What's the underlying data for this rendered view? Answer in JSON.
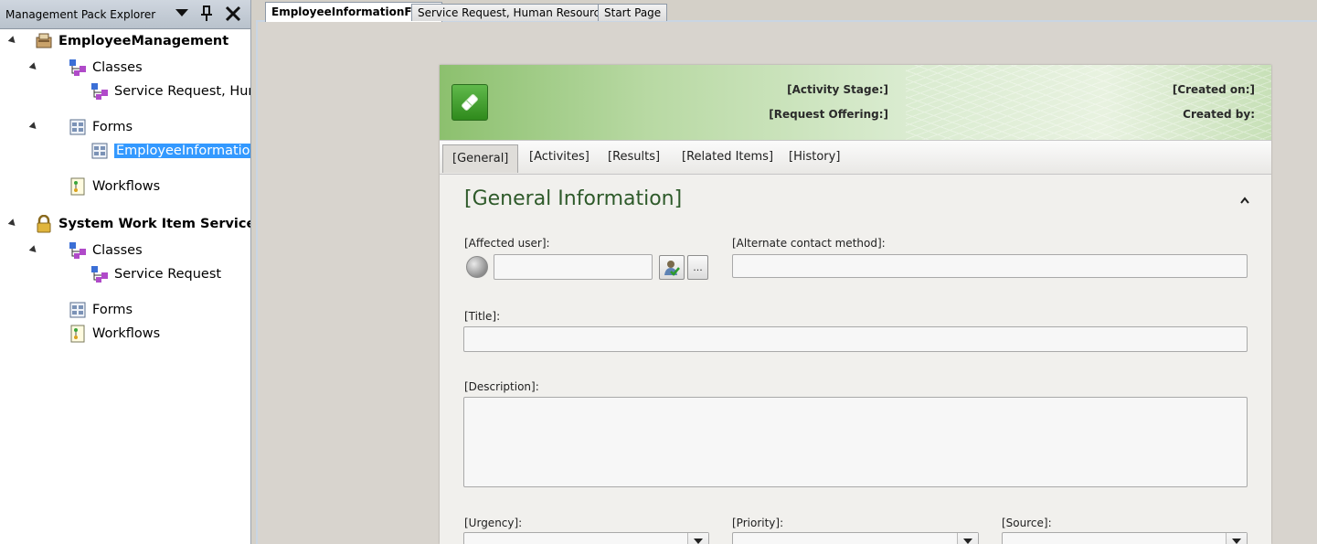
{
  "explorer": {
    "title": "Management Pack Explorer",
    "tree": [
      {
        "label": "EmployeeManagement",
        "icon": "management-pack-icon"
      },
      {
        "label": "Classes",
        "icon": "classes-icon"
      },
      {
        "label": "Service Request, Huma",
        "icon": "class-icon"
      },
      {
        "label": "Forms",
        "icon": "forms-icon"
      },
      {
        "label": "EmployeeInformationF",
        "icon": "form-icon",
        "selected": true
      },
      {
        "label": "Workflows",
        "icon": "workflows-icon"
      },
      {
        "label": "System Work Item Service Re",
        "icon": "lock-icon"
      },
      {
        "label": "Classes",
        "icon": "classes-icon"
      },
      {
        "label": "Service Request",
        "icon": "class-icon"
      },
      {
        "label": "Forms",
        "icon": "forms-icon"
      },
      {
        "label": "Workflows",
        "icon": "workflows-icon"
      }
    ]
  },
  "doc_tabs": [
    {
      "label": "EmployeeInformationForm",
      "active": true
    },
    {
      "label": "Service Request, Human Resources",
      "active": false
    },
    {
      "label": "Start Page",
      "active": false
    }
  ],
  "form": {
    "banner": {
      "activity_stage": "[Activity Stage:]",
      "request_offering": "[Request Offering:]",
      "created_on": "[Created on:]",
      "created_by": "Created by:"
    },
    "tabs": [
      "[General]",
      "[Activites]",
      "[Results]",
      "[Related Items]",
      "[History]"
    ],
    "section_title": "[General Information]",
    "fields": {
      "affected_user": "[Affected user]:",
      "alternate_contact": "[Alternate contact method]:",
      "title": "[Title]:",
      "description": "[Description]:",
      "urgency": "[Urgency]:",
      "priority": "[Priority]:",
      "source": "[Source]:"
    },
    "browse_button": "..."
  },
  "colors": {
    "banner_green": "#8cc06e",
    "selection_blue": "#3399ff",
    "section_title": "#2e5a2a"
  }
}
